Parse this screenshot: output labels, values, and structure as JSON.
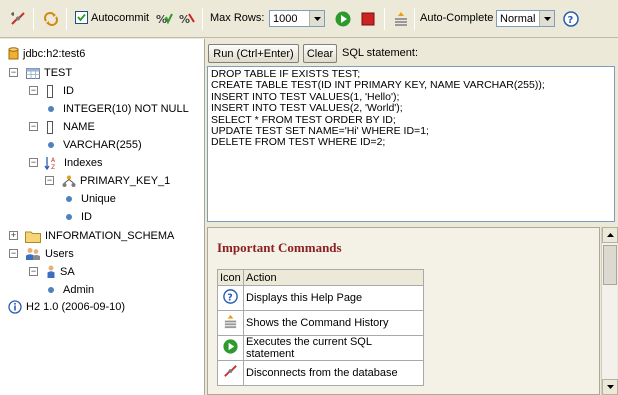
{
  "toolbar": {
    "autocommit_label": "Autocommit",
    "autocommit_checked": true,
    "max_rows_label": "Max Rows:",
    "max_rows_value": "1000",
    "auto_complete_label": "Auto-Complete",
    "auto_complete_value": "Normal"
  },
  "tree": {
    "connection": "jdbc:h2:test6",
    "table": "TEST",
    "col1": "ID",
    "col1_type": "INTEGER(10) NOT NULL",
    "col2": "NAME",
    "col2_type": "VARCHAR(255)",
    "indexes": "Indexes",
    "pk": "PRIMARY_KEY_1",
    "pk_unique": "Unique",
    "pk_col": "ID",
    "info_schema": "INFORMATION_SCHEMA",
    "users": "Users",
    "user_sa": "SA",
    "user_role": "Admin",
    "version": "H2 1.0 (2006-09-10)"
  },
  "query": {
    "run_label": "Run (Ctrl+Enter)",
    "clear_label": "Clear",
    "sql_label": "SQL statement:",
    "lines": [
      "DROP TABLE IF EXISTS TEST;",
      "CREATE TABLE TEST(ID INT PRIMARY KEY, NAME VARCHAR(255));",
      "INSERT INTO TEST VALUES(1, 'Hello');",
      "INSERT INTO TEST VALUES(2, 'World');",
      "SELECT * FROM TEST ORDER BY ID;",
      "UPDATE TEST SET NAME='Hi' WHERE ID=1;",
      "DELETE FROM TEST WHERE ID=2;"
    ]
  },
  "help": {
    "title": "Important Commands",
    "col_icon": "Icon",
    "col_action": "Action",
    "rows": [
      {
        "icon": "help-icon",
        "action": "Displays this Help Page"
      },
      {
        "icon": "history-icon",
        "action": "Shows the Command History"
      },
      {
        "icon": "run-icon",
        "action": "Executes the current SQL statement"
      },
      {
        "icon": "disconnect-icon",
        "action": "Disconnects from the database"
      }
    ]
  },
  "colors": {
    "run_green": "#2e9a2e",
    "stop_red": "#cc2222",
    "help_blue": "#2a5db0",
    "heading": "#8b2020"
  }
}
